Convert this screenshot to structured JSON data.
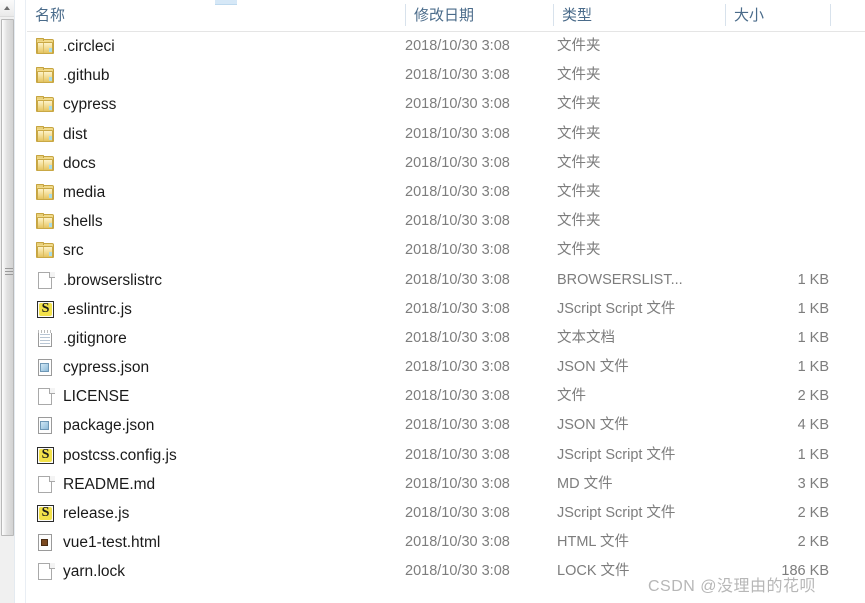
{
  "window": {
    "kind": "windows-file-explorer-details-view"
  },
  "columns": {
    "name": "名称",
    "date_modified": "修改日期",
    "type": "类型",
    "size": "大小"
  },
  "files": [
    {
      "name": ".circleci",
      "date": "2018/10/30 3:08",
      "type": "文件夹",
      "size": "",
      "icon": "folder-icon"
    },
    {
      "name": ".github",
      "date": "2018/10/30 3:08",
      "type": "文件夹",
      "size": "",
      "icon": "folder-icon"
    },
    {
      "name": "cypress",
      "date": "2018/10/30 3:08",
      "type": "文件夹",
      "size": "",
      "icon": "folder-icon"
    },
    {
      "name": "dist",
      "date": "2018/10/30 3:08",
      "type": "文件夹",
      "size": "",
      "icon": "folder-icon"
    },
    {
      "name": "docs",
      "date": "2018/10/30 3:08",
      "type": "文件夹",
      "size": "",
      "icon": "folder-icon"
    },
    {
      "name": "media",
      "date": "2018/10/30 3:08",
      "type": "文件夹",
      "size": "",
      "icon": "folder-icon"
    },
    {
      "name": "shells",
      "date": "2018/10/30 3:08",
      "type": "文件夹",
      "size": "",
      "icon": "folder-icon"
    },
    {
      "name": "src",
      "date": "2018/10/30 3:08",
      "type": "文件夹",
      "size": "",
      "icon": "folder-icon"
    },
    {
      "name": ".browserslistrc",
      "date": "2018/10/30 3:08",
      "type": "BROWSERSLIST...",
      "size": "1 KB",
      "icon": "blank-page-icon"
    },
    {
      "name": ".eslintrc.js",
      "date": "2018/10/30 3:08",
      "type": "JScript Script 文件",
      "size": "1 KB",
      "icon": "jscript-file-icon"
    },
    {
      "name": ".gitignore",
      "date": "2018/10/30 3:08",
      "type": "文本文档",
      "size": "1 KB",
      "icon": "text-document-icon"
    },
    {
      "name": "cypress.json",
      "date": "2018/10/30 3:08",
      "type": "JSON 文件",
      "size": "1 KB",
      "icon": "json-file-icon"
    },
    {
      "name": "LICENSE",
      "date": "2018/10/30 3:08",
      "type": "文件",
      "size": "2 KB",
      "icon": "blank-page-icon"
    },
    {
      "name": "package.json",
      "date": "2018/10/30 3:08",
      "type": "JSON 文件",
      "size": "4 KB",
      "icon": "json-file-icon"
    },
    {
      "name": "postcss.config.js",
      "date": "2018/10/30 3:08",
      "type": "JScript Script 文件",
      "size": "1 KB",
      "icon": "jscript-file-icon"
    },
    {
      "name": "README.md",
      "date": "2018/10/30 3:08",
      "type": "MD 文件",
      "size": "3 KB",
      "icon": "blank-page-icon"
    },
    {
      "name": "release.js",
      "date": "2018/10/30 3:08",
      "type": "JScript Script 文件",
      "size": "2 KB",
      "icon": "jscript-file-icon"
    },
    {
      "name": "vue1-test.html",
      "date": "2018/10/30 3:08",
      "type": "HTML 文件",
      "size": "2 KB",
      "icon": "html-file-icon"
    },
    {
      "name": "yarn.lock",
      "date": "2018/10/30 3:08",
      "type": "LOCK 文件",
      "size": "186 KB",
      "icon": "blank-page-icon"
    }
  ],
  "watermark": {
    "text": "CSDN @没理由的花呗"
  },
  "colors": {
    "header_text": "#4a6b8a",
    "name_text": "#1a1a1a",
    "meta_text": "#7d7d7d",
    "folder_fill": "#efd77f",
    "watermark": "#b7b7b7"
  }
}
